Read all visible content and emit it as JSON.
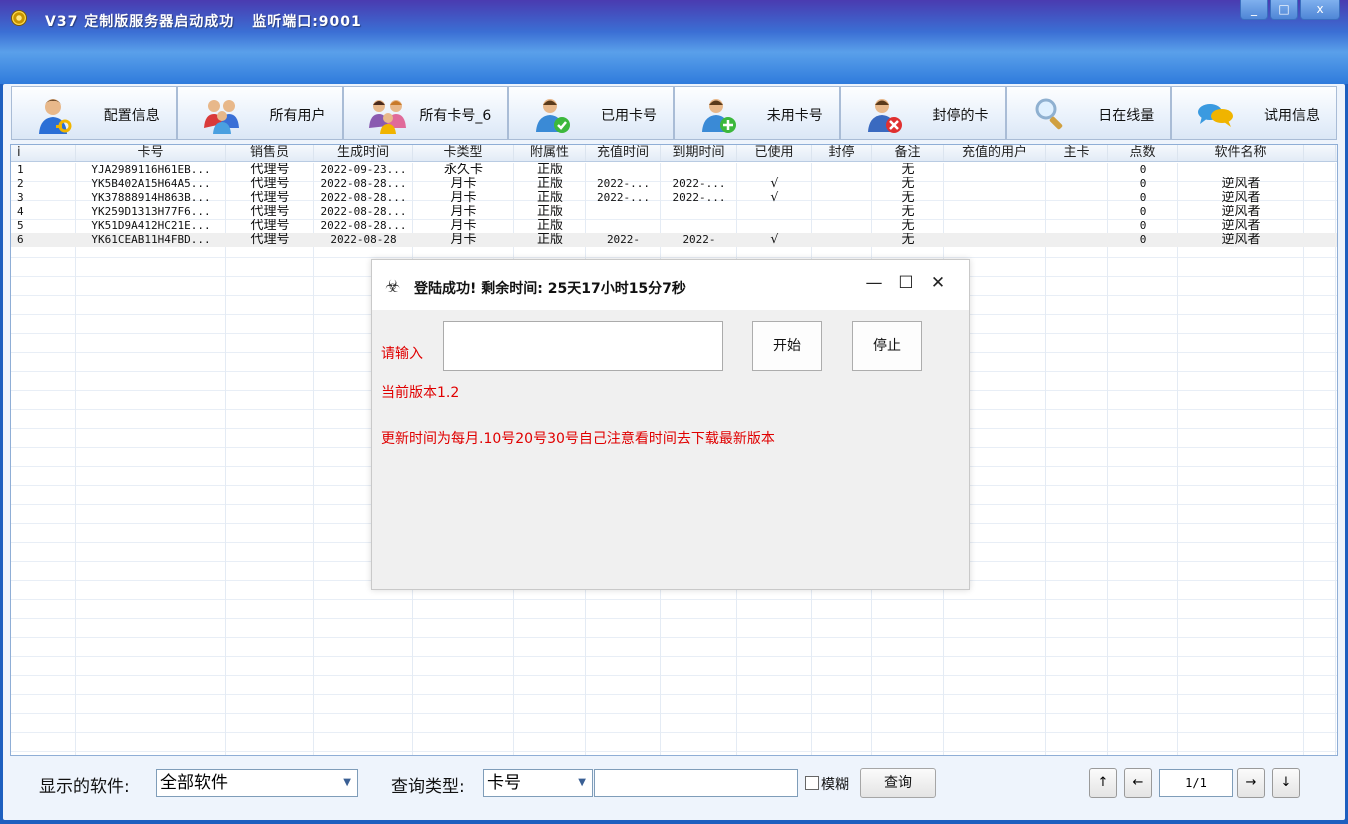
{
  "window": {
    "title_main": "V37 定制版服务器启动成功",
    "title_port": "监听端口:9001",
    "minimize": "_",
    "maximize": "□",
    "close": "x"
  },
  "toolbar": [
    {
      "label": "配置信息",
      "icon": "user-key-icon"
    },
    {
      "label": "所有用户",
      "icon": "users-icon"
    },
    {
      "label": "所有卡号_6",
      "icon": "group-icon"
    },
    {
      "label": "已用卡号",
      "icon": "user-check-icon"
    },
    {
      "label": "未用卡号",
      "icon": "user-add-icon"
    },
    {
      "label": "封停的卡",
      "icon": "user-block-icon"
    },
    {
      "label": "日在线量",
      "icon": "magnifier-icon"
    },
    {
      "label": "试用信息",
      "icon": "chat-icon"
    }
  ],
  "grid": {
    "columns": [
      "i",
      "卡号",
      "销售员",
      "生成时间",
      "卡类型",
      "附属性",
      "充值时间",
      "到期时间",
      "已使用",
      "封停",
      "备注",
      "充值的用户",
      "主卡",
      "点数",
      "软件名称",
      ""
    ],
    "rows": [
      [
        "1",
        "YJA2989116H61EB...",
        "代理号",
        "2022-09-23...",
        "永久卡",
        "正版",
        "",
        "",
        "",
        "",
        "无",
        "",
        "",
        "0",
        "",
        ""
      ],
      [
        "2",
        "YK5B402A15H64A5...",
        "代理号",
        "2022-08-28...",
        "月卡",
        "正版",
        "2022-...",
        "2022-...",
        "√",
        "",
        "无",
        "",
        "",
        "0",
        "逆风者",
        ""
      ],
      [
        "3",
        "YK37888914H863B...",
        "代理号",
        "2022-08-28...",
        "月卡",
        "正版",
        "2022-...",
        "2022-...",
        "√",
        "",
        "无",
        "",
        "",
        "0",
        "逆风者",
        ""
      ],
      [
        "4",
        "YK259D1313H77F6...",
        "代理号",
        "2022-08-28...",
        "月卡",
        "正版",
        "",
        "",
        "",
        "",
        "无",
        "",
        "",
        "0",
        "逆风者",
        ""
      ],
      [
        "5",
        "YK51D9A412HC21E...",
        "代理号",
        "2022-08-28...",
        "月卡",
        "正版",
        "",
        "",
        "",
        "",
        "无",
        "",
        "",
        "0",
        "逆风者",
        ""
      ],
      [
        "6",
        "YK61CEAB11H4FBD...",
        "代理号",
        "2022-08-28",
        "月卡",
        "正版",
        "2022-",
        "2022-",
        "√",
        "",
        "无",
        "",
        "",
        "0",
        "逆风者",
        ""
      ]
    ]
  },
  "bottom": {
    "software_label": "显示的软件:",
    "software_value": "全部软件",
    "query_type_label": "查询类型:",
    "query_type_value": "卡号",
    "query_text": "",
    "fuzzy_label": "模糊",
    "query_button": "查询",
    "nav_first": "↑",
    "nav_prev": "←",
    "page": "1/1",
    "nav_next": "→",
    "nav_last": "↓"
  },
  "dialog": {
    "title": "登陆成功! 剩余时间: 25天17小时15分7秒",
    "icon": "biohazard-icon",
    "minimize": "—",
    "maximize": "☐",
    "close": "✕",
    "input_label": "请输入",
    "input_value": "",
    "start_button": "开始",
    "stop_button": "停止",
    "version": "当前版本1.2",
    "notice": "更新时间为每月.10号20号30号自己注意看时间去下载最新版本"
  },
  "colors": {
    "titlebar": "#3b6fd4",
    "notice_red": "#e00000",
    "grid_border": "#8faed6"
  }
}
